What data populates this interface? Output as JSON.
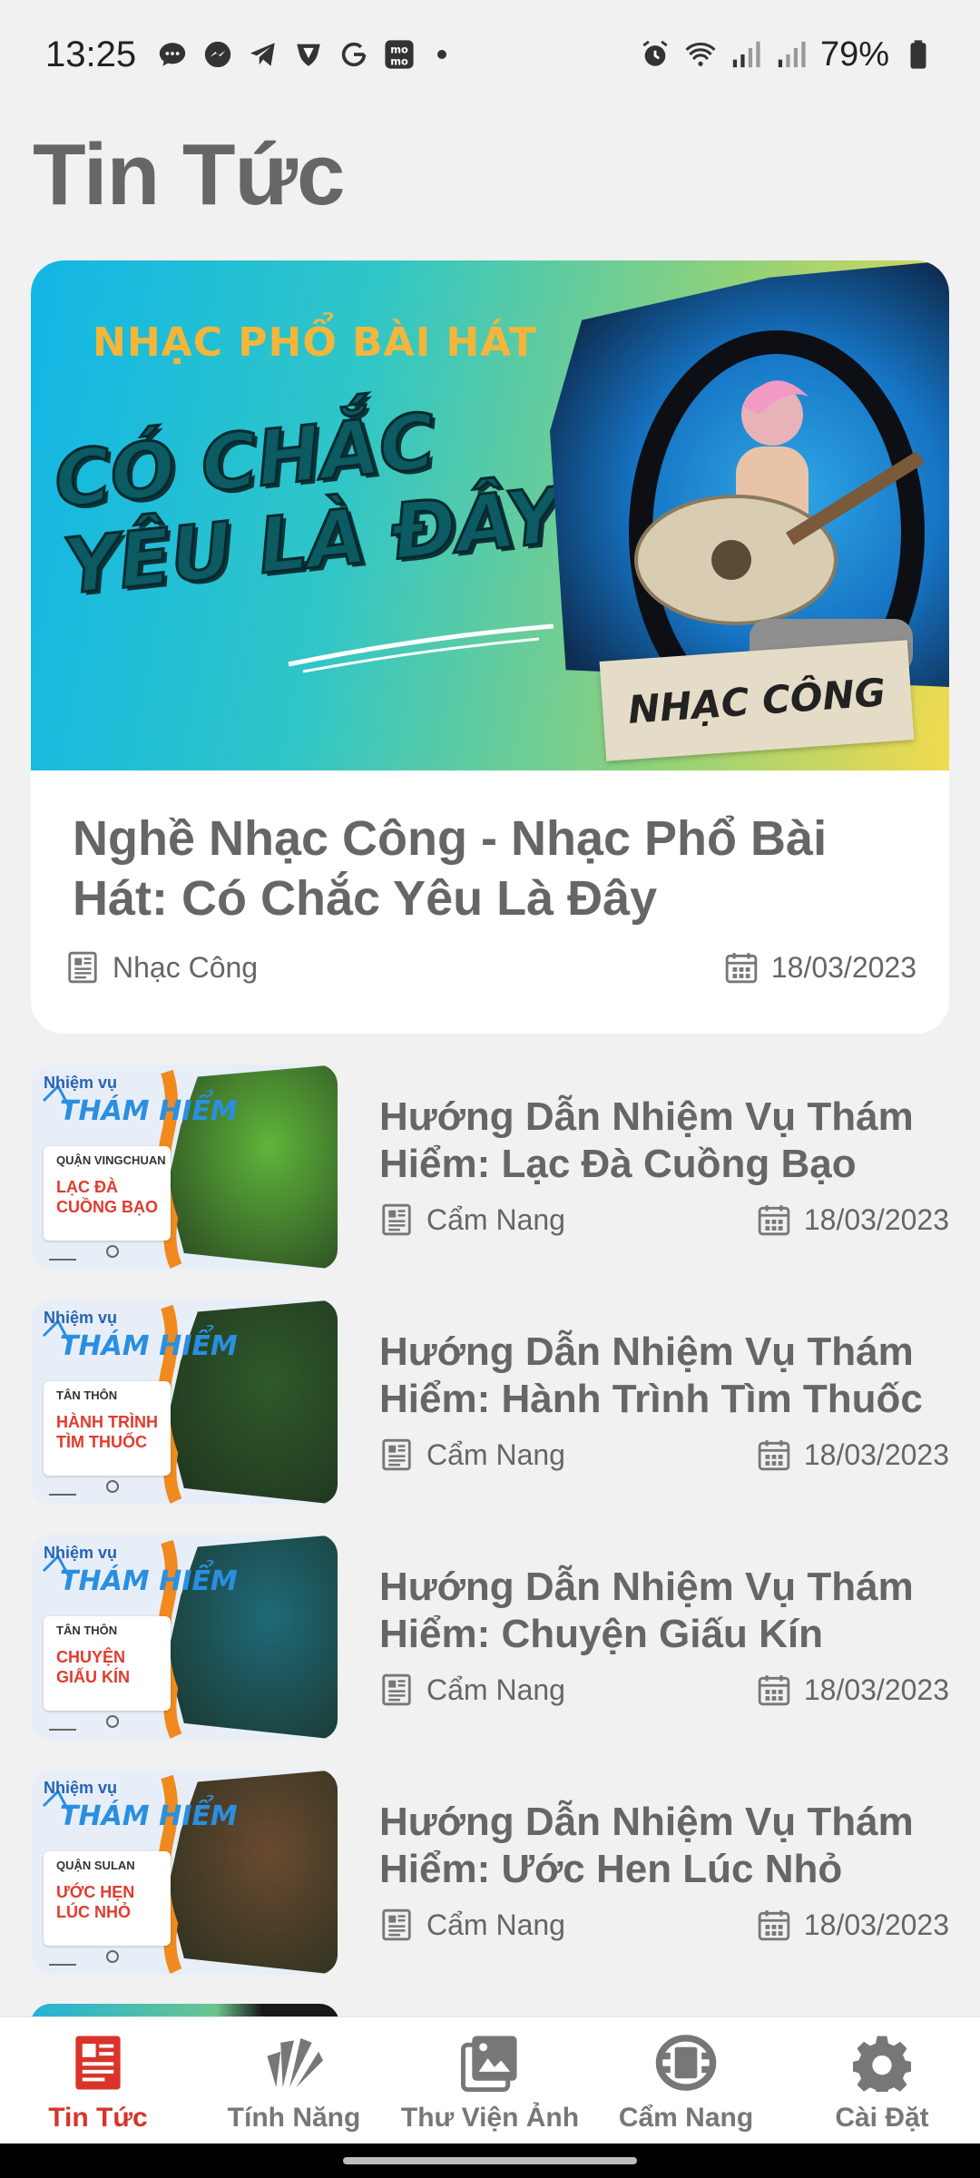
{
  "status_bar": {
    "time": "13:25",
    "battery": "79%",
    "left_icons": [
      "chat-bubble-icon",
      "messenger-icon",
      "telegram-icon",
      "shield-icon",
      "g-icon",
      "momo-icon",
      "dot-icon"
    ],
    "right_icons": [
      "alarm-icon",
      "wifi-icon",
      "signal-icon",
      "signal-icon",
      "battery-icon"
    ]
  },
  "page": {
    "title": "Tin Tức"
  },
  "featured": {
    "banner": {
      "kicker": "NHẠC PHỔ BÀI HÁT",
      "headline": "CÓ CHẮC YÊU LÀ ĐÂY",
      "tag": "NHẠC CÔNG"
    },
    "title": "Nghề Nhạc Công - Nhạc Phổ Bài Hát: Có Chắc Yêu Là Đây",
    "category": "Nhạc Công",
    "date": "18/03/2023"
  },
  "articles": [
    {
      "title": "Hướng Dẫn Nhiệm Vụ Thám Hiểm: Lạc Đà Cuồng Bạo",
      "category": "Cẩm Nang",
      "date": "18/03/2023",
      "thumb": {
        "kicker": "Nhiệm vụ",
        "heading": "THÁM HIỂM",
        "sub": "QUẬN VINGCHUAN",
        "main": "LẠC ĐÀ CUỒNG BẠO",
        "scene_color": "#5fb53a"
      }
    },
    {
      "title": "Hướng Dẫn Nhiệm Vụ Thám Hiểm: Hành Trình Tìm Thuốc",
      "category": "Cẩm Nang",
      "date": "18/03/2023",
      "thumb": {
        "kicker": "Nhiệm vụ",
        "heading": "THÁM HIỂM",
        "sub": "TÂN THÔN",
        "main": "HÀNH TRÌNH TÌM THUỐC",
        "scene_color": "#2f5a2a"
      }
    },
    {
      "title": "Hướng Dẫn Nhiệm Vụ Thám Hiểm: Chuyện Giấu Kín",
      "category": "Cẩm Nang",
      "date": "18/03/2023",
      "thumb": {
        "kicker": "Nhiệm vụ",
        "heading": "THÁM HIỂM",
        "sub": "TÂN THÔN",
        "main": "CHUYỆN GIẤU KÍN",
        "scene_color": "#1e6a78"
      }
    },
    {
      "title": "Hướng Dẫn Nhiệm Vụ Thám Hiểm: Ước Hen Lúc Nhỏ",
      "category": "Cẩm Nang",
      "date": "18/03/2023",
      "thumb": {
        "kicker": "Nhiệm vụ",
        "heading": "THÁM HIỂM",
        "sub": "QUẬN SULAN",
        "main": "ƯỚC HẸN LÚC NHỎ",
        "scene_color": "#6a4a30"
      }
    }
  ],
  "bottom_nav": [
    {
      "label": "Tin Tức",
      "icon": "newspaper-icon",
      "active": true
    },
    {
      "label": "Tính Năng",
      "icon": "brush-fan-icon",
      "active": false
    },
    {
      "label": "Thư Viện Ảnh",
      "icon": "photo-gallery-icon",
      "active": false
    },
    {
      "label": "Cẩm Nang",
      "icon": "handbook-icon",
      "active": false
    },
    {
      "label": "Cài Đặt",
      "icon": "gear-icon",
      "active": false
    }
  ],
  "colors": {
    "accent": "#d8342a",
    "text_muted": "#666666",
    "background": "#f1f1f1"
  }
}
